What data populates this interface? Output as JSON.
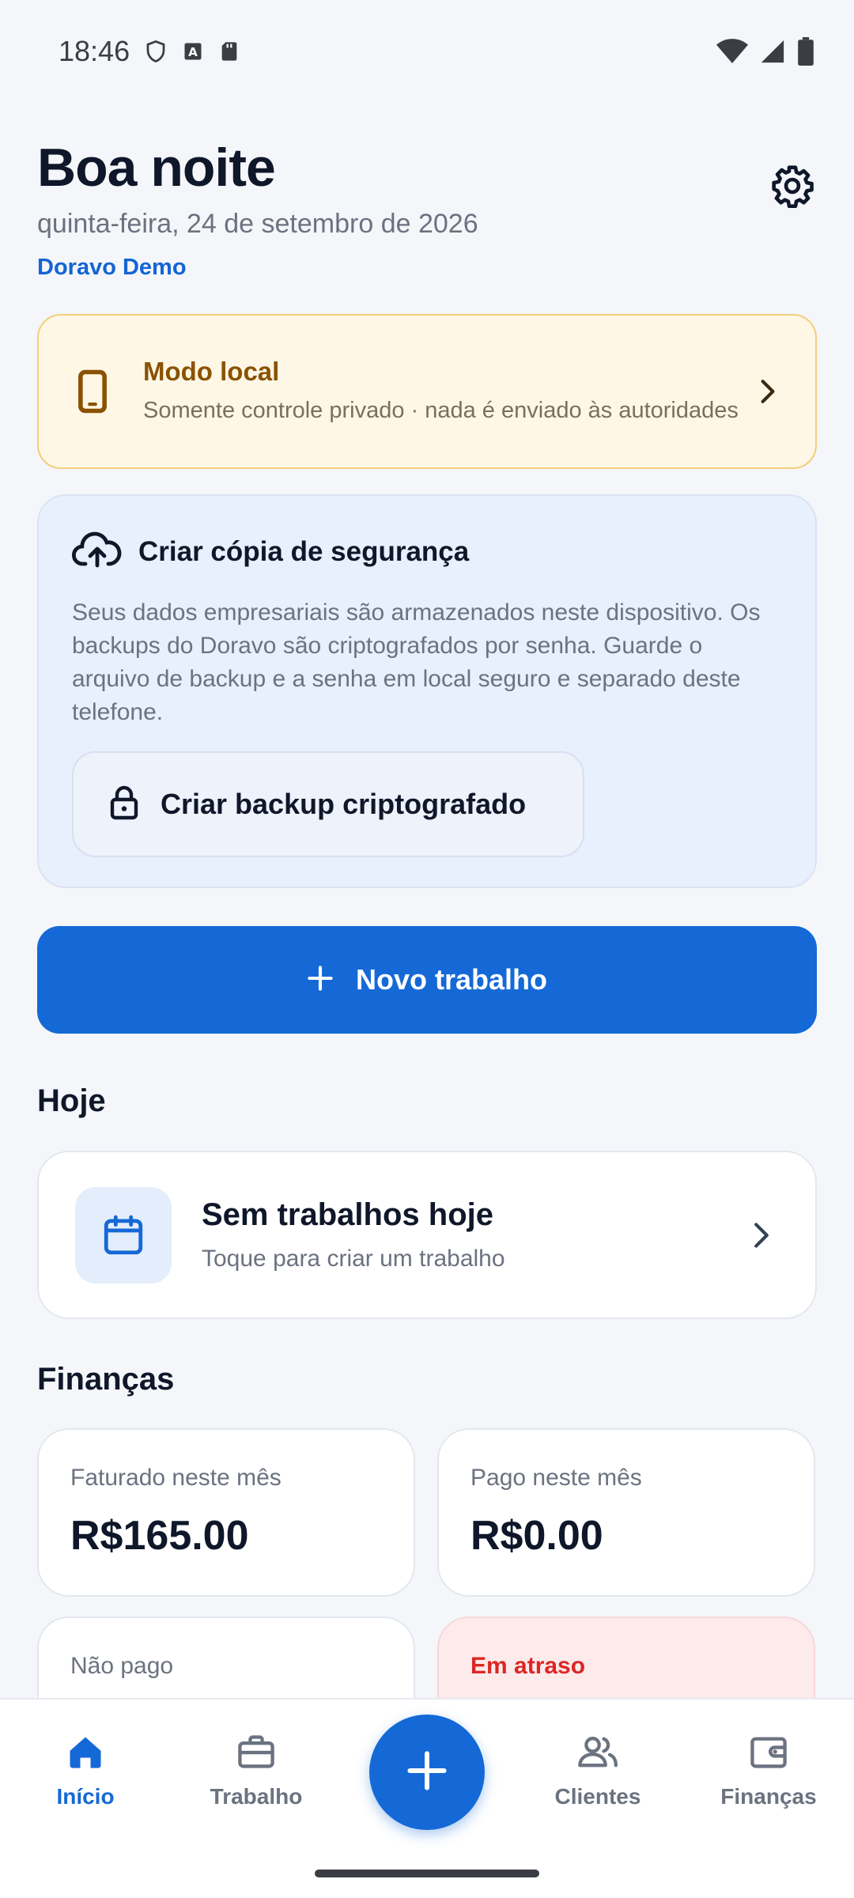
{
  "status_bar": {
    "time": "18:46",
    "icons": [
      "shield-icon",
      "a-notification-icon",
      "sd-card-icon",
      "wifi-icon",
      "signal-icon",
      "battery-icon"
    ]
  },
  "header": {
    "greeting": "Boa noite",
    "date": "quinta-feira, 24 de setembro de 2026",
    "company": "Doravo Demo"
  },
  "local_mode": {
    "title": "Modo local",
    "subtitle": "Somente controle privado · nada é enviado às autoridades"
  },
  "backup": {
    "title": "Criar cópia de segurança",
    "description": "Seus dados empresariais são armazenados neste dispositivo. Os backups do Doravo são criptografados por senha. Guarde o arquivo de backup e a senha em local seguro e separado deste telefone.",
    "button_label": "Criar backup criptografado"
  },
  "new_job_label": "Novo trabalho",
  "today": {
    "section_title": "Hoje",
    "card_title": "Sem trabalhos hoje",
    "card_subtitle": "Toque para criar um trabalho"
  },
  "finances": {
    "section_title": "Finanças",
    "cards": [
      {
        "label": "Faturado neste mês",
        "value": "R$165.00"
      },
      {
        "label": "Pago neste mês",
        "value": "R$0.00"
      },
      {
        "label": "Não pago",
        "value": ""
      },
      {
        "label": "Em atraso",
        "value": ""
      }
    ]
  },
  "bottom_nav": {
    "items": [
      {
        "label": "Início",
        "icon": "home-icon",
        "active": true
      },
      {
        "label": "Trabalho",
        "icon": "briefcase-icon",
        "active": false
      },
      {
        "label": "Clientes",
        "icon": "people-icon",
        "active": false
      },
      {
        "label": "Finanças",
        "icon": "wallet-icon",
        "active": false
      }
    ]
  },
  "colors": {
    "primary": "#1569d6",
    "warning_bg": "#fff7e6",
    "warning_text": "#8a5200",
    "danger": "#dc2626",
    "backup_bg": "#e8effd"
  }
}
